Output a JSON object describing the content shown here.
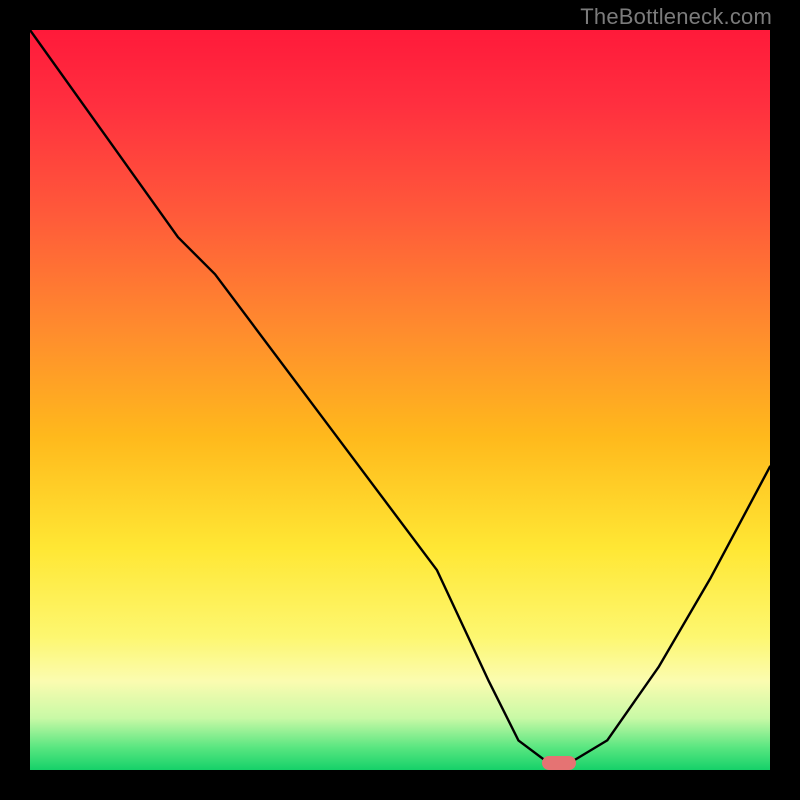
{
  "watermark": "TheBottleneck.com",
  "colors": {
    "marker": "#e57373",
    "curve": "#000000"
  },
  "chart_data": {
    "type": "line",
    "title": "",
    "xlabel": "",
    "ylabel": "",
    "xlim": [
      0,
      100
    ],
    "ylim": [
      0,
      100
    ],
    "x": [
      0,
      10,
      20,
      25,
      40,
      55,
      62,
      66,
      70,
      73,
      78,
      85,
      92,
      100
    ],
    "values": [
      100,
      86,
      72,
      67,
      47,
      27,
      12,
      4,
      1,
      1,
      4,
      14,
      26,
      41
    ],
    "marker": {
      "x": 71.5,
      "y": 1
    },
    "grid": false,
    "legend": false
  }
}
